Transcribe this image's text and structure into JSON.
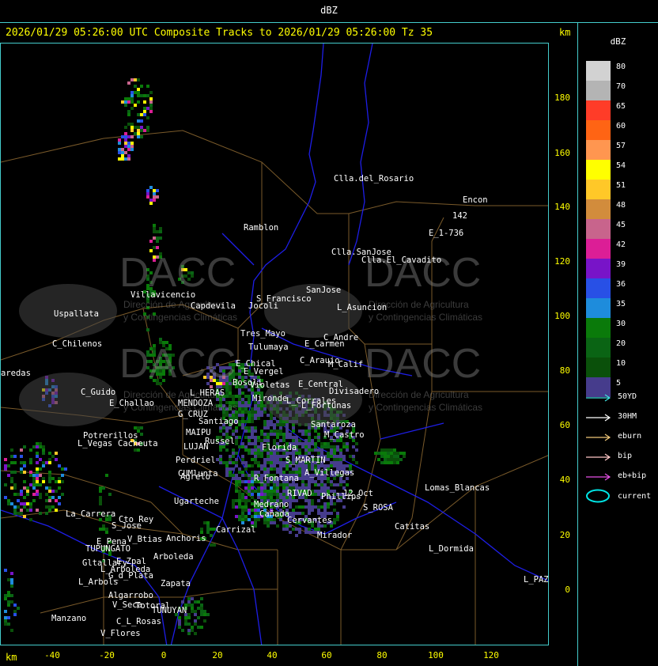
{
  "top_label": "dBZ",
  "title": "2026/01/29 05:26:00 UTC Composite Tracks to 2026/01/29 05:26:00 Tz 35",
  "km_label": "km",
  "y_ticks": [
    "180",
    "160",
    "140",
    "120",
    "100",
    "80",
    "60",
    "40",
    "20",
    "0"
  ],
  "x_ticks": [
    "-40",
    "-20",
    "0",
    "20",
    "40",
    "60",
    "80",
    "100",
    "120"
  ],
  "legend": {
    "title": "dBZ",
    "levels": [
      {
        "label": "80",
        "color": "#d2d2d2"
      },
      {
        "label": "70",
        "color": "#b4b4b4"
      },
      {
        "label": "65",
        "color": "#ff3c28"
      },
      {
        "label": "60",
        "color": "#ff6414"
      },
      {
        "label": "57",
        "color": "#ff9650"
      },
      {
        "label": "54",
        "color": "#ffff00"
      },
      {
        "label": "51",
        "color": "#ffc828"
      },
      {
        "label": "48",
        "color": "#d28c3c"
      },
      {
        "label": "45",
        "color": "#c8648c"
      },
      {
        "label": "42",
        "color": "#dc1e96"
      },
      {
        "label": "39",
        "color": "#7814c8"
      },
      {
        "label": "36",
        "color": "#2850e6"
      },
      {
        "label": "35",
        "color": "#1e8cdc"
      },
      {
        "label": "30",
        "color": "#0a7a0a"
      },
      {
        "label": "20",
        "color": "#0a6414"
      },
      {
        "label": "10",
        "color": "#0a500a"
      },
      {
        "label": "5",
        "color": "#463c8c"
      }
    ],
    "tracks": [
      {
        "label": "50YD",
        "color": "#40e0e0"
      },
      {
        "label": "30HM",
        "color": "#ffffff"
      },
      {
        "label": "eburn",
        "color": "#f0c878"
      },
      {
        "label": "bip",
        "color": "#ffc8c8"
      },
      {
        "label": "eb+bip",
        "color": "#e650e6"
      }
    ],
    "current_label": "current",
    "current_color": "#00e6e6"
  },
  "watermark": {
    "name": "DACC",
    "line1": "Dirección de Agricultura",
    "line2": "y Contingencias Climáticas"
  },
  "towns": [
    "Clla.del_Rosario",
    "Encon",
    "142",
    "E_1-736",
    "Ramblon",
    "Clla.SanJose",
    "Clla.El_Cavadito",
    "Villavicencio",
    "S_Francisco",
    "SanJose",
    "Capdevila",
    "Jocoli",
    "L_Asuncion",
    "Uspallata",
    "Tres_Mayo",
    "Tulumaya",
    "C_Andre",
    "E_Carmen",
    "C_Chilenos",
    "E_Chical",
    "E_Vergel",
    "C_Arauio",
    "M_Calif",
    "aredas",
    "Bosoli",
    "Violetas",
    "E_Central",
    "Divisadero",
    "C_Guido",
    "L_HERAS",
    "Mironde",
    "E_Challao",
    "MENDOZA",
    "L_Corrales",
    "L_Fortunas",
    "G_CRUZ",
    "Santiago",
    "Santaroza",
    "Potrerillos",
    "MAIPU",
    "Russel",
    "L_Vegas",
    "Cacheuta",
    "LUJAN",
    "Florida",
    "M_Castro",
    "Perdriel",
    "CUMlunta",
    "S_MARTIN",
    "Agrelo",
    "A_Villegas",
    "R_Fontana",
    "Lomas_Blancas",
    "Ugarteche",
    "RIVAD",
    "Phillips",
    "12_Oct",
    "S_ROSA",
    "La_Carrera",
    "Cto_Rey",
    "Medrano",
    "Cañada",
    "S_Jose",
    "Carrizal",
    "Cervantes",
    "Catitas",
    "Mirador",
    "E_Pena",
    "V_Btias",
    "Anchoris",
    "TUPUNGATO",
    "L_Dormida",
    "Arboleda",
    "E_Zpal",
    "Gltallary",
    "L_Arboleda",
    "G_d_Plata",
    "L_PAZ",
    "L_Arbols",
    "Zapata",
    "Algarrobo",
    "V_Seca",
    "Totoral",
    "TUNUYAN",
    "Manzano",
    "C_L_Rosas",
    "V_Flores"
  ]
}
